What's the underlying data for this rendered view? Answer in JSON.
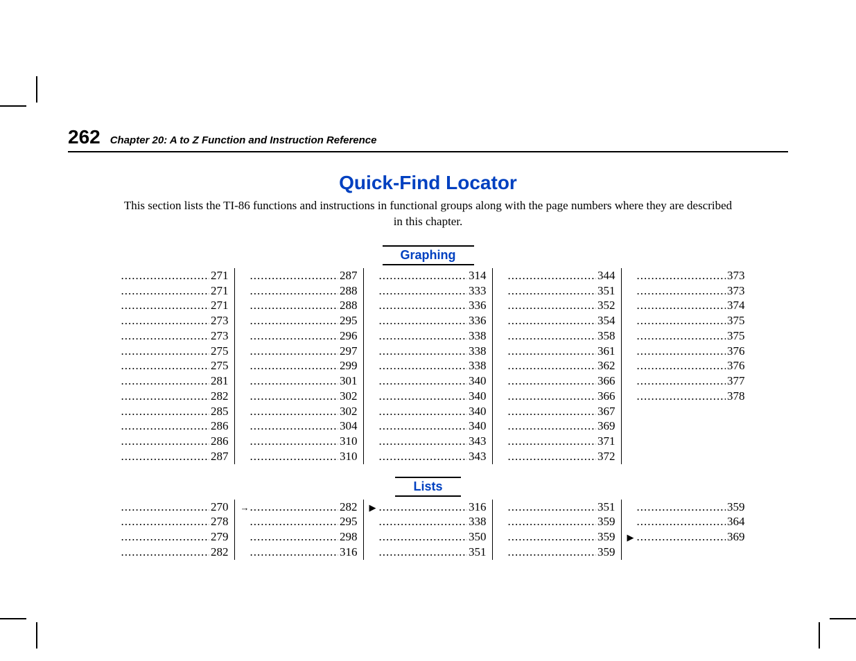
{
  "header": {
    "page_number": "262",
    "chapter": "Chapter 20: A to Z Function and Instruction Reference"
  },
  "title": "Quick-Find Locator",
  "intro": "This section lists the TI-86 functions and instructions in functional groups along with the page numbers where they are described in this chapter.",
  "sections": [
    {
      "label": "Graphing",
      "columns": [
        [
          {
            "g": "",
            "p": "271"
          },
          {
            "g": "",
            "p": "271"
          },
          {
            "g": "",
            "p": "271"
          },
          {
            "g": "",
            "p": "273"
          },
          {
            "g": "",
            "p": "273"
          },
          {
            "g": "",
            "p": "275"
          },
          {
            "g": "",
            "p": "275"
          },
          {
            "g": "",
            "p": "281"
          },
          {
            "g": "",
            "p": "282"
          },
          {
            "g": "",
            "p": "285"
          },
          {
            "g": "",
            "p": "286"
          },
          {
            "g": "",
            "p": "286"
          },
          {
            "g": "",
            "p": "287"
          }
        ],
        [
          {
            "g": "",
            "p": "287"
          },
          {
            "g": "",
            "p": "288"
          },
          {
            "g": "",
            "p": "288"
          },
          {
            "g": "",
            "p": "295"
          },
          {
            "g": "",
            "p": "296"
          },
          {
            "g": "",
            "p": "297"
          },
          {
            "g": "",
            "p": "299"
          },
          {
            "g": "",
            "p": "301"
          },
          {
            "g": "",
            "p": "302"
          },
          {
            "g": "",
            "p": "302"
          },
          {
            "g": "",
            "p": "304"
          },
          {
            "g": "",
            "p": "310"
          },
          {
            "g": "",
            "p": "310"
          }
        ],
        [
          {
            "g": "",
            "p": "314"
          },
          {
            "g": "",
            "p": "333"
          },
          {
            "g": "",
            "p": "336"
          },
          {
            "g": "",
            "p": "336"
          },
          {
            "g": "",
            "p": "338"
          },
          {
            "g": "",
            "p": "338"
          },
          {
            "g": "",
            "p": "338"
          },
          {
            "g": "",
            "p": "340"
          },
          {
            "g": "",
            "p": "340"
          },
          {
            "g": "",
            "p": "340"
          },
          {
            "g": "",
            "p": "340"
          },
          {
            "g": "",
            "p": "343"
          },
          {
            "g": "",
            "p": "343"
          }
        ],
        [
          {
            "g": "",
            "p": "344"
          },
          {
            "g": "",
            "p": "351"
          },
          {
            "g": "",
            "p": "352"
          },
          {
            "g": "",
            "p": "354"
          },
          {
            "g": "",
            "p": "358"
          },
          {
            "g": "",
            "p": "361"
          },
          {
            "g": "",
            "p": "362"
          },
          {
            "g": "",
            "p": "366"
          },
          {
            "g": "",
            "p": "366"
          },
          {
            "g": "",
            "p": "367"
          },
          {
            "g": "",
            "p": "369"
          },
          {
            "g": "",
            "p": "371"
          },
          {
            "g": "",
            "p": "372"
          }
        ],
        [
          {
            "g": "",
            "p": "373"
          },
          {
            "g": "",
            "p": "373"
          },
          {
            "g": "",
            "p": "374"
          },
          {
            "g": "",
            "p": "375"
          },
          {
            "g": "",
            "p": "375"
          },
          {
            "g": "",
            "p": "376"
          },
          {
            "g": "",
            "p": "376"
          },
          {
            "g": "",
            "p": "377"
          },
          {
            "g": "",
            "p": "378"
          }
        ]
      ]
    },
    {
      "label": "Lists",
      "columns": [
        [
          {
            "g": "",
            "p": "270"
          },
          {
            "g": "",
            "p": "278"
          },
          {
            "g": "",
            "p": "279"
          },
          {
            "g": "",
            "p": "282"
          }
        ],
        [
          {
            "g": "→",
            "p": "282"
          },
          {
            "g": "",
            "p": "295"
          },
          {
            "g": "",
            "p": "298"
          },
          {
            "g": "",
            "p": "316"
          }
        ],
        [
          {
            "g": "▶",
            "p": "316"
          },
          {
            "g": "",
            "p": "338"
          },
          {
            "g": "",
            "p": "350"
          },
          {
            "g": "",
            "p": "351"
          }
        ],
        [
          {
            "g": "",
            "p": "351"
          },
          {
            "g": "",
            "p": "359"
          },
          {
            "g": "",
            "p": "359"
          },
          {
            "g": "",
            "p": "359"
          }
        ],
        [
          {
            "g": "",
            "p": "359"
          },
          {
            "g": "",
            "p": "364"
          },
          {
            "g": "▶",
            "p": "369"
          }
        ]
      ]
    }
  ]
}
